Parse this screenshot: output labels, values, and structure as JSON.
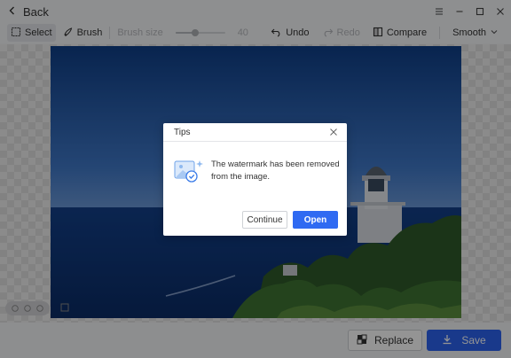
{
  "titlebar": {
    "back_label": "Back",
    "icons": [
      "menu-icon",
      "minimize-icon",
      "maximize-icon",
      "close-icon"
    ]
  },
  "toolbar": {
    "select_label": "Select",
    "brush_label": "Brush",
    "brush_size_label": "Brush size",
    "brush_size_value": "40",
    "brush_size_fraction": 0.4,
    "undo_label": "Undo",
    "redo_label": "Redo",
    "compare_label": "Compare",
    "smooth_label": "Smooth"
  },
  "canvas": {
    "photo_subject": "lighthouse-coast-photo"
  },
  "bottom": {
    "replace_label": "Replace",
    "save_label": "Save"
  },
  "dialog": {
    "title": "Tips",
    "message": "The watermark has been removed from the image.",
    "continue_label": "Continue",
    "open_label": "Open"
  },
  "colors": {
    "accent": "#2b63ef",
    "overlay": "rgba(0,0,0,0.42)"
  }
}
